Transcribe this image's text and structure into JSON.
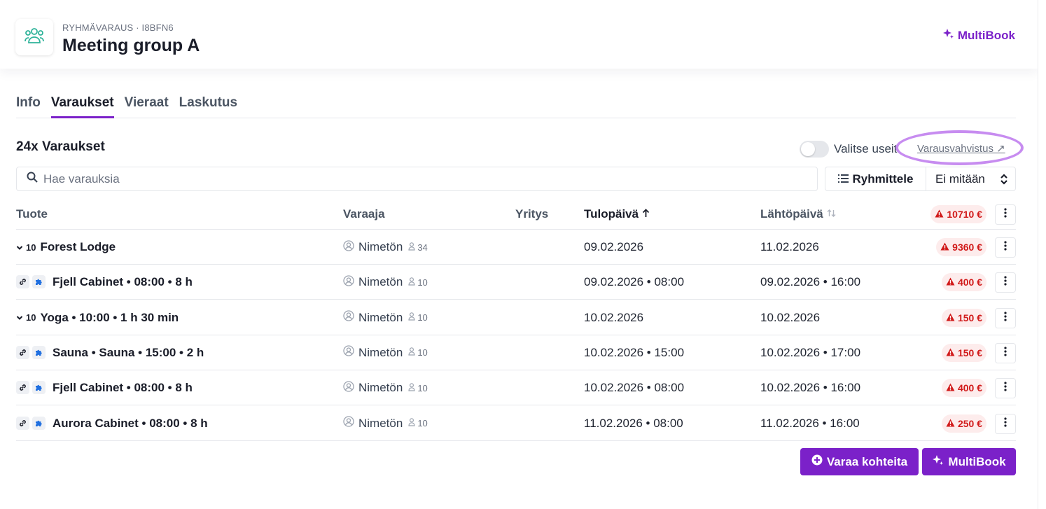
{
  "header": {
    "eyebrow": "RYHMÄVARAUS · I8BFN6",
    "title": "Meeting group A",
    "brand_label": "MultiBook",
    "group_icon": "people-group-icon",
    "brand_icon": "sparkle-icon"
  },
  "colors": {
    "accent": "#7b21c9",
    "danger": "#d11a1a",
    "danger_bg": "#fdecec",
    "highlight": "#c78cf0",
    "icon_green": "#2fb39a"
  },
  "tabs": [
    {
      "label": "Info",
      "active": false
    },
    {
      "label": "Varaukset",
      "active": true
    },
    {
      "label": "Vieraat",
      "active": false
    },
    {
      "label": "Laskutus",
      "active": false
    }
  ],
  "section": {
    "title": "24x Varaukset",
    "toggle_label": "Valitse useita",
    "toggle_on": false,
    "confirm_link": "Varausvahvistus ↗"
  },
  "search": {
    "placeholder": "Hae varauksia",
    "value": ""
  },
  "grouping": {
    "button_label": "Ryhmittele",
    "selected": "Ei mitään"
  },
  "table": {
    "columns": {
      "product": "Tuote",
      "booker": "Varaaja",
      "company": "Yritys",
      "arrival": "Tulopäivä",
      "departure": "Lähtöpäivä"
    },
    "total_price": "10710 €",
    "rows": [
      {
        "kind": "group",
        "count": "10",
        "product": "Forest Lodge",
        "booker": "Nimetön",
        "guests": "34",
        "company": "",
        "arrival": "09.02.2026",
        "departure": "11.02.2026",
        "price": "9360 €"
      },
      {
        "kind": "linked",
        "product": "Fjell Cabinet • 08:00 • 8 h",
        "booker": "Nimetön",
        "guests": "10",
        "company": "",
        "arrival": "09.02.2026 • 08:00",
        "departure": "09.02.2026 • 16:00",
        "price": "400 €"
      },
      {
        "kind": "group",
        "count": "10",
        "product": "Yoga • 10:00 • 1 h 30 min",
        "booker": "Nimetön",
        "guests": "10",
        "company": "",
        "arrival": "10.02.2026",
        "departure": "10.02.2026",
        "price": "150 €"
      },
      {
        "kind": "linked",
        "product": "Sauna • Sauna • 15:00 • 2 h",
        "booker": "Nimetön",
        "guests": "10",
        "company": "",
        "arrival": "10.02.2026 • 15:00",
        "departure": "10.02.2026 • 17:00",
        "price": "150 €"
      },
      {
        "kind": "linked",
        "product": "Fjell Cabinet • 08:00 • 8 h",
        "booker": "Nimetön",
        "guests": "10",
        "company": "",
        "arrival": "10.02.2026 • 08:00",
        "departure": "10.02.2026 • 16:00",
        "price": "400 €"
      },
      {
        "kind": "linked",
        "product": "Aurora Cabinet • 08:00 • 8 h",
        "booker": "Nimetön",
        "guests": "10",
        "company": "",
        "arrival": "11.02.2026 • 08:00",
        "departure": "11.02.2026 • 16:00",
        "price": "250 €"
      }
    ]
  },
  "actions": {
    "book_label": "Varaa kohteita",
    "multibook_label": "MultiBook"
  }
}
